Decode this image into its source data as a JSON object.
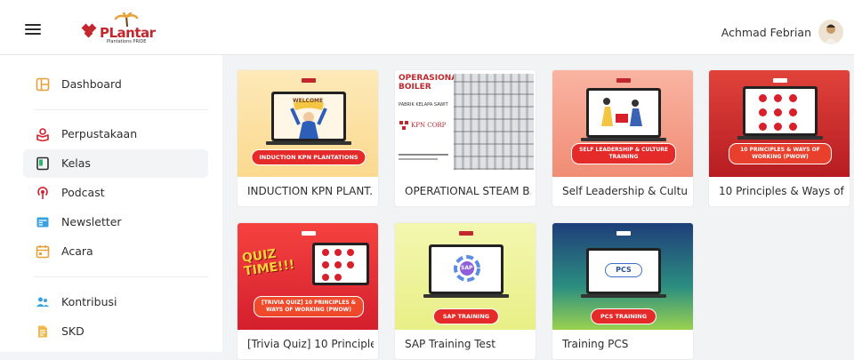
{
  "header": {
    "logo_text": "PLantar",
    "logo_sub": "Plantations PRIDE",
    "user_name": "Achmad Febrian"
  },
  "sidebar": {
    "items": [
      {
        "label": "Dashboard",
        "icon": "dashboard-icon"
      },
      {
        "label": "Perpustakaan",
        "icon": "library-icon"
      },
      {
        "label": "Kelas",
        "icon": "class-icon",
        "active": true
      },
      {
        "label": "Podcast",
        "icon": "podcast-icon"
      },
      {
        "label": "Newsletter",
        "icon": "newsletter-icon"
      },
      {
        "label": "Acara",
        "icon": "calendar-icon"
      },
      {
        "label": "Kontribusi",
        "icon": "contribution-icon"
      },
      {
        "label": "SKD",
        "icon": "document-icon"
      }
    ]
  },
  "courses": [
    {
      "title": "INDUCTION KPN PLANT...",
      "thumb_banner": "INDUCTION KPN PLANTATIONS",
      "thumb_sign": "WELCOME"
    },
    {
      "title": "OPERATIONAL STEAM B...",
      "thumb_heading": "OPERASIONAL BOILER",
      "thumb_sub": "PABRIK KELAPA SAWIT",
      "thumb_brand": "KPN CORP"
    },
    {
      "title": "Self Leadership & Cultur...",
      "thumb_banner": "SELF LEADERSHIP & CULTURE TRAINING"
    },
    {
      "title": "10 Principles & Ways of ...",
      "thumb_banner": "10 PRINCIPLES & WAYS OF WORKING (PWOW)"
    },
    {
      "title": "[Trivia Quiz] 10 Principle...",
      "thumb_quiz": "QUIZ TIME!!!",
      "thumb_banner": "[TRIVIA QUIZ] 10 PRINCIPLES & WAYS OF WORKING (PWOW)"
    },
    {
      "title": "SAP Training Test",
      "thumb_banner": "SAP TRAINING",
      "thumb_logo": "SAP"
    },
    {
      "title": "Training PCS",
      "thumb_banner": "PCS TRAINING",
      "thumb_logo": "PCS"
    }
  ],
  "colors": {
    "brand_red": "#c1272d",
    "accent_orange": "#e8a13a"
  }
}
